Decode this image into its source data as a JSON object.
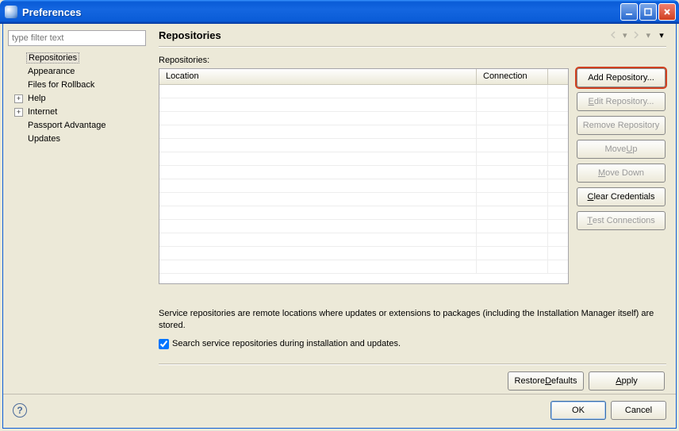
{
  "window": {
    "title": "Preferences"
  },
  "filter": {
    "placeholder": "type filter text"
  },
  "tree": {
    "items": [
      {
        "label": "Repositories",
        "expandable": false,
        "selected": true
      },
      {
        "label": "Appearance",
        "expandable": false
      },
      {
        "label": "Files for Rollback",
        "expandable": false
      },
      {
        "label": "Help",
        "expandable": true
      },
      {
        "label": "Internet",
        "expandable": true
      },
      {
        "label": "Passport Advantage",
        "expandable": false
      },
      {
        "label": "Updates",
        "expandable": false
      }
    ]
  },
  "page": {
    "title": "Repositories",
    "repos_label": "Repositories:",
    "columns": {
      "location": "Location",
      "connection": "Connection"
    },
    "rows": []
  },
  "buttons": {
    "add": "Add Repository...",
    "edit": "Edit Repository...",
    "remove": "Remove Repository",
    "move_up": "Move Up",
    "move_down": "Move Down",
    "clear_creds": "Clear Credentials",
    "test_conn": "Test Connections",
    "restore_defaults": "Restore Defaults",
    "apply": "Apply",
    "ok": "OK",
    "cancel": "Cancel"
  },
  "help_text": "Service repositories are remote locations where updates or extensions to packages (including the Installation Manager itself) are stored.",
  "checkbox": {
    "checked": true,
    "label": "Search service repositories during installation and updates."
  }
}
